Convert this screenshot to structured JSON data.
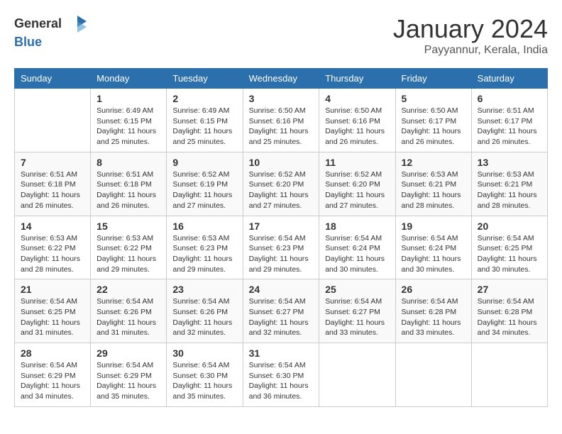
{
  "header": {
    "logo_general": "General",
    "logo_blue": "Blue",
    "month_title": "January 2024",
    "location": "Payyannur, Kerala, India"
  },
  "columns": [
    "Sunday",
    "Monday",
    "Tuesday",
    "Wednesday",
    "Thursday",
    "Friday",
    "Saturday"
  ],
  "weeks": [
    {
      "days": [
        {
          "number": "",
          "sunrise": "",
          "sunset": "",
          "daylight": ""
        },
        {
          "number": "1",
          "sunrise": "Sunrise: 6:49 AM",
          "sunset": "Sunset: 6:15 PM",
          "daylight": "Daylight: 11 hours and 25 minutes."
        },
        {
          "number": "2",
          "sunrise": "Sunrise: 6:49 AM",
          "sunset": "Sunset: 6:15 PM",
          "daylight": "Daylight: 11 hours and 25 minutes."
        },
        {
          "number": "3",
          "sunrise": "Sunrise: 6:50 AM",
          "sunset": "Sunset: 6:16 PM",
          "daylight": "Daylight: 11 hours and 25 minutes."
        },
        {
          "number": "4",
          "sunrise": "Sunrise: 6:50 AM",
          "sunset": "Sunset: 6:16 PM",
          "daylight": "Daylight: 11 hours and 26 minutes."
        },
        {
          "number": "5",
          "sunrise": "Sunrise: 6:50 AM",
          "sunset": "Sunset: 6:17 PM",
          "daylight": "Daylight: 11 hours and 26 minutes."
        },
        {
          "number": "6",
          "sunrise": "Sunrise: 6:51 AM",
          "sunset": "Sunset: 6:17 PM",
          "daylight": "Daylight: 11 hours and 26 minutes."
        }
      ]
    },
    {
      "days": [
        {
          "number": "7",
          "sunrise": "Sunrise: 6:51 AM",
          "sunset": "Sunset: 6:18 PM",
          "daylight": "Daylight: 11 hours and 26 minutes."
        },
        {
          "number": "8",
          "sunrise": "Sunrise: 6:51 AM",
          "sunset": "Sunset: 6:18 PM",
          "daylight": "Daylight: 11 hours and 26 minutes."
        },
        {
          "number": "9",
          "sunrise": "Sunrise: 6:52 AM",
          "sunset": "Sunset: 6:19 PM",
          "daylight": "Daylight: 11 hours and 27 minutes."
        },
        {
          "number": "10",
          "sunrise": "Sunrise: 6:52 AM",
          "sunset": "Sunset: 6:20 PM",
          "daylight": "Daylight: 11 hours and 27 minutes."
        },
        {
          "number": "11",
          "sunrise": "Sunrise: 6:52 AM",
          "sunset": "Sunset: 6:20 PM",
          "daylight": "Daylight: 11 hours and 27 minutes."
        },
        {
          "number": "12",
          "sunrise": "Sunrise: 6:53 AM",
          "sunset": "Sunset: 6:21 PM",
          "daylight": "Daylight: 11 hours and 28 minutes."
        },
        {
          "number": "13",
          "sunrise": "Sunrise: 6:53 AM",
          "sunset": "Sunset: 6:21 PM",
          "daylight": "Daylight: 11 hours and 28 minutes."
        }
      ]
    },
    {
      "days": [
        {
          "number": "14",
          "sunrise": "Sunrise: 6:53 AM",
          "sunset": "Sunset: 6:22 PM",
          "daylight": "Daylight: 11 hours and 28 minutes."
        },
        {
          "number": "15",
          "sunrise": "Sunrise: 6:53 AM",
          "sunset": "Sunset: 6:22 PM",
          "daylight": "Daylight: 11 hours and 29 minutes."
        },
        {
          "number": "16",
          "sunrise": "Sunrise: 6:53 AM",
          "sunset": "Sunset: 6:23 PM",
          "daylight": "Daylight: 11 hours and 29 minutes."
        },
        {
          "number": "17",
          "sunrise": "Sunrise: 6:54 AM",
          "sunset": "Sunset: 6:23 PM",
          "daylight": "Daylight: 11 hours and 29 minutes."
        },
        {
          "number": "18",
          "sunrise": "Sunrise: 6:54 AM",
          "sunset": "Sunset: 6:24 PM",
          "daylight": "Daylight: 11 hours and 30 minutes."
        },
        {
          "number": "19",
          "sunrise": "Sunrise: 6:54 AM",
          "sunset": "Sunset: 6:24 PM",
          "daylight": "Daylight: 11 hours and 30 minutes."
        },
        {
          "number": "20",
          "sunrise": "Sunrise: 6:54 AM",
          "sunset": "Sunset: 6:25 PM",
          "daylight": "Daylight: 11 hours and 30 minutes."
        }
      ]
    },
    {
      "days": [
        {
          "number": "21",
          "sunrise": "Sunrise: 6:54 AM",
          "sunset": "Sunset: 6:25 PM",
          "daylight": "Daylight: 11 hours and 31 minutes."
        },
        {
          "number": "22",
          "sunrise": "Sunrise: 6:54 AM",
          "sunset": "Sunset: 6:26 PM",
          "daylight": "Daylight: 11 hours and 31 minutes."
        },
        {
          "number": "23",
          "sunrise": "Sunrise: 6:54 AM",
          "sunset": "Sunset: 6:26 PM",
          "daylight": "Daylight: 11 hours and 32 minutes."
        },
        {
          "number": "24",
          "sunrise": "Sunrise: 6:54 AM",
          "sunset": "Sunset: 6:27 PM",
          "daylight": "Daylight: 11 hours and 32 minutes."
        },
        {
          "number": "25",
          "sunrise": "Sunrise: 6:54 AM",
          "sunset": "Sunset: 6:27 PM",
          "daylight": "Daylight: 11 hours and 33 minutes."
        },
        {
          "number": "26",
          "sunrise": "Sunrise: 6:54 AM",
          "sunset": "Sunset: 6:28 PM",
          "daylight": "Daylight: 11 hours and 33 minutes."
        },
        {
          "number": "27",
          "sunrise": "Sunrise: 6:54 AM",
          "sunset": "Sunset: 6:28 PM",
          "daylight": "Daylight: 11 hours and 34 minutes."
        }
      ]
    },
    {
      "days": [
        {
          "number": "28",
          "sunrise": "Sunrise: 6:54 AM",
          "sunset": "Sunset: 6:29 PM",
          "daylight": "Daylight: 11 hours and 34 minutes."
        },
        {
          "number": "29",
          "sunrise": "Sunrise: 6:54 AM",
          "sunset": "Sunset: 6:29 PM",
          "daylight": "Daylight: 11 hours and 35 minutes."
        },
        {
          "number": "30",
          "sunrise": "Sunrise: 6:54 AM",
          "sunset": "Sunset: 6:30 PM",
          "daylight": "Daylight: 11 hours and 35 minutes."
        },
        {
          "number": "31",
          "sunrise": "Sunrise: 6:54 AM",
          "sunset": "Sunset: 6:30 PM",
          "daylight": "Daylight: 11 hours and 36 minutes."
        },
        {
          "number": "",
          "sunrise": "",
          "sunset": "",
          "daylight": ""
        },
        {
          "number": "",
          "sunrise": "",
          "sunset": "",
          "daylight": ""
        },
        {
          "number": "",
          "sunrise": "",
          "sunset": "",
          "daylight": ""
        }
      ]
    }
  ]
}
